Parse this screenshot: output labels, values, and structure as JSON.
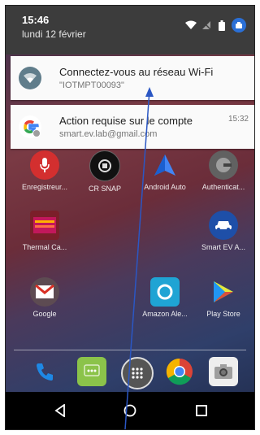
{
  "status": {
    "time": "15:46",
    "date": "lundi 12 février"
  },
  "notifications": [
    {
      "title": "Connectez-vous au réseau Wi-Fi",
      "subtitle": "\"IOTMPT00093\"",
      "icon": "wifi-icon",
      "time": ""
    },
    {
      "title": "Action requise sur le compte",
      "subtitle": "smart.ev.lab@gmail.com",
      "icon": "google-icon",
      "time": "15:32"
    }
  ],
  "apps_row1": [
    {
      "label": "Enregistreur...",
      "icon": "microphone-icon"
    },
    {
      "label": "CR SNAP",
      "icon": "cr-snap-icon"
    },
    {
      "label": "Android Auto",
      "icon": "android-auto-icon"
    },
    {
      "label": "Authenticat...",
      "icon": "authenticator-icon"
    }
  ],
  "apps_row2": [
    {
      "label": "Thermal Ca...",
      "icon": "thermal-camera-icon",
      "badge": "THERMAL CAMERA"
    },
    {
      "label": "Smart EV A...",
      "icon": "car-icon"
    }
  ],
  "apps_row3": [
    {
      "label": "Google",
      "icon": "gmail-folder-icon"
    },
    {
      "label": "Amazon Ale...",
      "icon": "alexa-icon"
    },
    {
      "label": "Play Store",
      "icon": "play-store-icon"
    }
  ],
  "dock": [
    {
      "icon": "phone-icon"
    },
    {
      "icon": "messaging-icon"
    },
    {
      "icon": "app-drawer-icon"
    },
    {
      "icon": "chrome-icon"
    },
    {
      "icon": "camera-icon"
    }
  ],
  "colors": {
    "accent_blue": "#2a6fd6",
    "annotation_line": "#2b57c4"
  }
}
